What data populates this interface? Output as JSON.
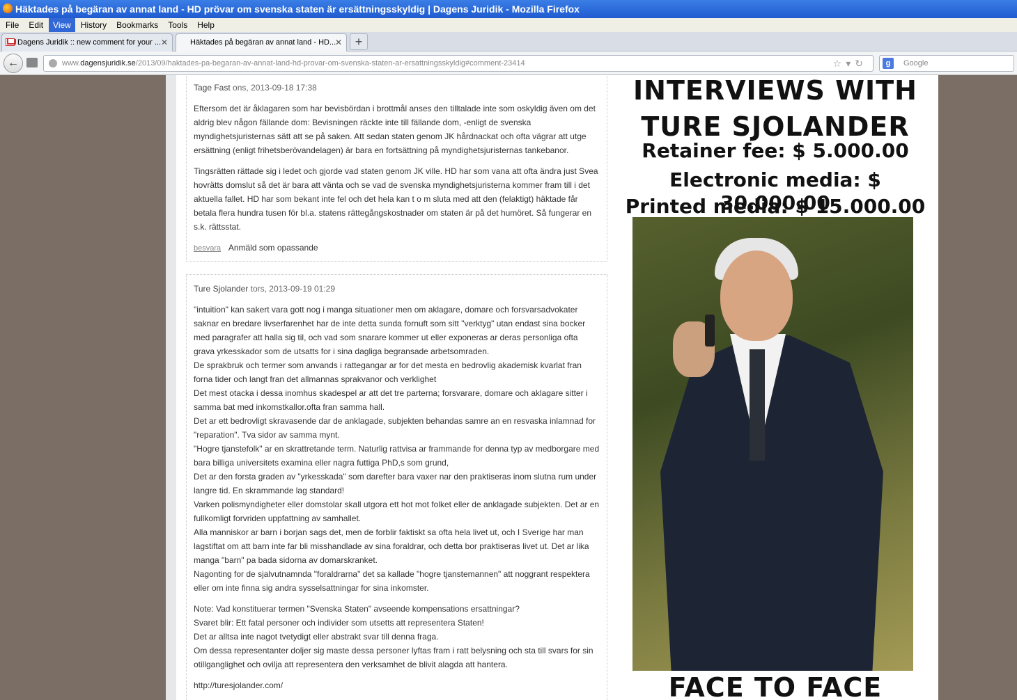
{
  "window": {
    "title": "Häktades på begäran av annat land - HD prövar om svenska staten är ersättningsskyldig | Dagens Juridik - Mozilla Firefox"
  },
  "menu": [
    "File",
    "Edit",
    "View",
    "History",
    "Bookmarks",
    "Tools",
    "Help"
  ],
  "tabs": [
    {
      "label": "Dagens Juridik :: new comment for your ..."
    },
    {
      "label": "Häktades på begäran av annat land - HD..."
    }
  ],
  "url": {
    "prefix": "www.",
    "host": "dagensjuridik.se",
    "path": "/2013/09/haktades-pa-begaran-av-annat-land-hd-provar-om-svenska-staten-ar-ersattningsskyldig#comment-23414"
  },
  "search": {
    "placeholder": "Google"
  },
  "comments": [
    {
      "author": "Tage Fast",
      "date": "ons, 2013-09-18 17:38",
      "paragraphs": [
        "Eftersom det är åklagaren som har bevisbördan i brottmål anses den tilltalade inte som oskyldig även om det aldrig blev någon fällande dom: Bevisningen räckte inte till fällande dom, -enligt de svenska myndighetsjuristernas sätt att se på saken. Att sedan staten genom JK hårdnackat och ofta vägrar att utge ersättning (enligt frihetsberövandelagen) är bara en fortsättning på myndighetsjuristernas tankebanor.",
        "Tingsrätten rättade sig i ledet och gjorde vad staten genom JK ville. HD har som vana att ofta ändra just Svea hovrätts domslut så det är bara att vänta och se vad de svenska myndighetsjuristerna kommer fram till i det aktuella fallet. HD har som bekant inte fel och det hela kan t o m sluta med att den (felaktigt) häktade får betala flera hundra tusen för bl.a. statens rättegångskostnader om staten är på det humöret. Så fungerar en s.k. rättsstat."
      ],
      "reply": "besvara",
      "report": "Anmäld som opassande"
    },
    {
      "author": "Ture Sjolander",
      "date": "tors, 2013-09-19 01:29",
      "paragraphs": [
        "\"intuition\" kan sakert vara gott nog i manga situationer men om aklagare, domare och forsvarsadvokater saknar en bredare livserfarenhet har de inte detta sunda fornuft som sitt \"verktyg\" utan endast sina bocker med paragrafer att halla sig til, och vad som snarare kommer ut eller exponeras ar deras personliga ofta grava yrkesskador som de utsatts for i sina dagliga begransade arbetsomraden.\nDe sprakbruk och termer som anvands i rattegangar ar for det mesta en bedrovlig akademisk kvarlat fran forna tider och langt fran det allmannas sprakvanor och verklighet\nDet mest otacka i dessa inomhus skadespel ar att det tre parterna; forsvarare, domare och aklagare sitter i samma bat med inkomstkallor.ofta fran samma hall.\nDet ar ett bedrovligt skravasende dar de anklagade, subjekten behandas samre an en resvaska inlamnad for \"reparation\". Tva sidor av samma mynt.\n\"Hogre tjanstefolk\" ar en skrattretande term. Naturlig rattvisa ar frammande for denna typ av medborgare med bara billiga universitets examina eller nagra futtiga PhD,s som grund,\nDet ar den forsta graden av \"yrkesskada\" som darefter bara vaxer nar den praktiseras inom slutna rum under langre tid. En skrammande lag standard!\nVarken polismyndigheter eller domstolar skall utgora ett hot mot folket eller de anklagade subjekten. Det ar en fullkomligt forvriden uppfattning av samhallet.\nAlla manniskor ar barn i borjan sags det, men de forblir faktiskt sa ofta hela livet ut, och I Sverige har man lagstiftat om att barn inte far bli misshandlade av sina foraldrar, och detta bor praktiseras livet ut. Det ar lika manga \"barn\" pa bada sidorna av domarskranket.\nNagonting for de sjalvutnamnda \"foraldrarna\" det sa kallade \"hogre tjanstemannen\" att noggrant respektera eller om inte finna sig andra sysselsattningar for sina inkomster.",
        "Note: Vad konstituerar termen \"Svenska Staten\" avseende kompensations ersattningar?\nSvaret blir: Ett fatal personer och individer som utsetts att representera Staten!\nDet ar alltsa inte nagot tvetydigt eller abstrakt svar till denna fraga.\nOm dessa representanter doljer sig maste dessa personer lyftas fram i ratt belysning och sta till svars for sin otillganglighet och ovilja att representera den verksamhet de blivit alagda att hantera.",
        "http://turesjolander.com/"
      ]
    }
  ],
  "ad": {
    "line1": "INTERVIEWS WITH",
    "line2": "TURE SJOLANDER",
    "line3": "Retainer fee: $ 5.000.00",
    "line4": "Electronic media: $ 30.000.00",
    "line5": "Printed media: $ 15.000.00",
    "line6": "FACE TO FACE"
  },
  "colors": {
    "titlebar": "#1f5bd0",
    "page_background": "#7b6f65",
    "content_background": "#ffffff"
  }
}
